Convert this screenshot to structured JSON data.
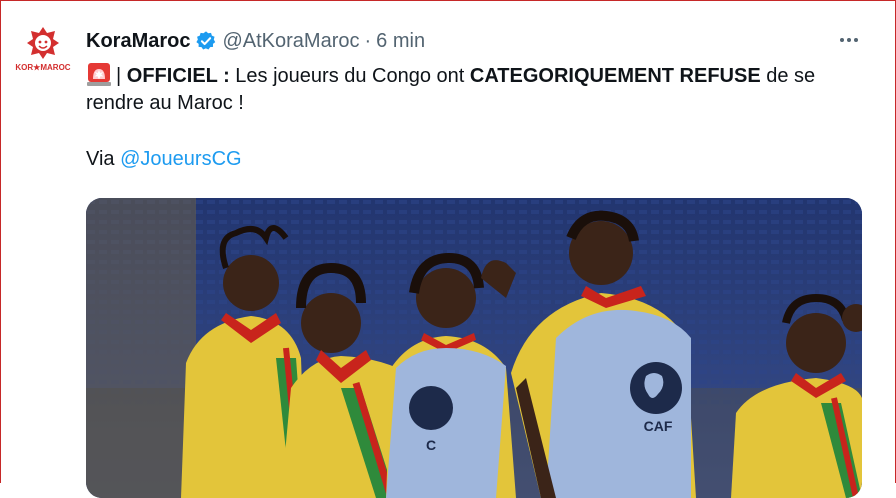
{
  "tweet": {
    "avatar": {
      "brand_text": "KOR★MAROC",
      "icon": "lion-icon",
      "colors": {
        "primary": "#d32f2f",
        "accent": "#1b8e3e"
      }
    },
    "author_name": "KoraMaroc",
    "verified_icon": "verified-badge-icon",
    "handle": "@AtKoraMaroc",
    "separator": "·",
    "time": "6 min",
    "more_icon": "more-options-icon",
    "text": {
      "emoji_icon": "police-light-icon",
      "prefix": "| ",
      "bold1": "OFFICIEL :",
      "mid": " Les joueurs du Congo ont ",
      "bold2": "CATEGORIQUEMENT REFUSE",
      "tail_line1": " de se",
      "line2": "rendre au Maroc !",
      "via_label": "Via ",
      "via_mention": "@JoueursCG"
    },
    "media": {
      "alt_icon": "photo",
      "bib_logo_text": "CAF",
      "colors": {
        "stadium": "#2a3d78",
        "jersey_yellow": "#e3c53a",
        "jersey_red": "#c8241c",
        "jersey_green": "#2f8a3b",
        "bib": "#9fb6dc"
      }
    }
  }
}
